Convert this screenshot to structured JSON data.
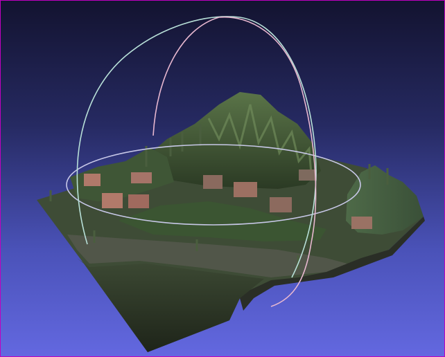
{
  "viewer": {
    "background_top": "#131330",
    "background_bottom": "#6368e0",
    "frame_color": "#c000c0",
    "trackball_colors": [
      "#b8e0d8",
      "#e8b8d0",
      "#c8c8e8"
    ]
  },
  "model": {
    "type": "textured-terrain-mesh",
    "content": "village-on-hill"
  }
}
